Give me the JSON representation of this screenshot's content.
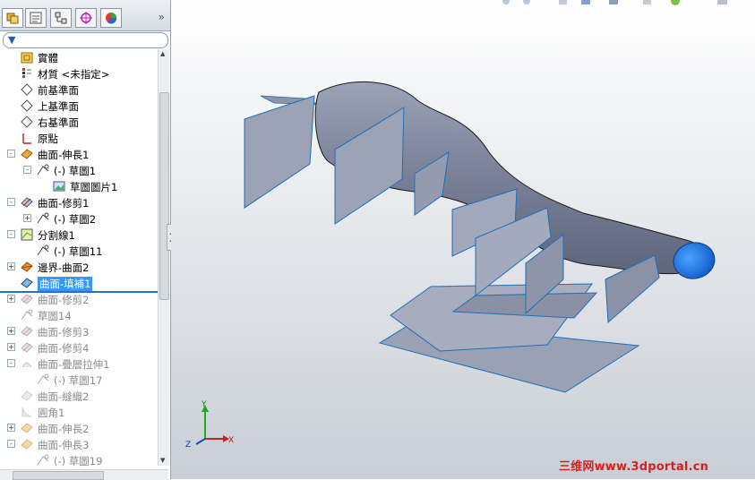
{
  "feature_tree": {
    "tabs": [
      {
        "name": "featuremanager-tab-icon"
      },
      {
        "name": "propertymanager-tab-icon"
      },
      {
        "name": "configurationmanager-tab-icon"
      },
      {
        "name": "dimxpert-tab-icon"
      },
      {
        "name": "display-manager-tab-icon"
      }
    ],
    "collapse_glyph": "»",
    "filter_icon": "filter-icon",
    "items": [
      {
        "label": "實體",
        "icon": "solid-body-folder-icon",
        "indent": 0,
        "expand": "",
        "state": "normal"
      },
      {
        "label": "材質 <未指定>",
        "icon": "material-icon",
        "indent": 0,
        "expand": "",
        "state": "normal"
      },
      {
        "label": "前基準面",
        "icon": "plane-icon",
        "indent": 0,
        "expand": "",
        "state": "normal"
      },
      {
        "label": "上基準面",
        "icon": "plane-icon",
        "indent": 0,
        "expand": "",
        "state": "normal"
      },
      {
        "label": "右基準面",
        "icon": "plane-icon",
        "indent": 0,
        "expand": "",
        "state": "normal"
      },
      {
        "label": "原點",
        "icon": "origin-icon",
        "indent": 0,
        "expand": "",
        "state": "normal"
      },
      {
        "label": "曲面-伸長1",
        "icon": "surface-extrude-icon",
        "indent": 0,
        "expand": "-",
        "state": "normal"
      },
      {
        "label": "(-) 草圖1",
        "icon": "sketch-icon",
        "indent": 1,
        "expand": "-",
        "state": "normal"
      },
      {
        "label": "草圖圖片1",
        "icon": "sketch-picture-icon",
        "indent": 2,
        "expand": "",
        "state": "normal"
      },
      {
        "label": "曲面-修剪1",
        "icon": "surface-trim-icon",
        "indent": 0,
        "expand": "-",
        "state": "normal"
      },
      {
        "label": "(-) 草圖2",
        "icon": "sketch-icon",
        "indent": 1,
        "expand": "+",
        "state": "normal"
      },
      {
        "label": "分割線1",
        "icon": "split-line-icon",
        "indent": 0,
        "expand": "-",
        "state": "normal"
      },
      {
        "label": "(-) 草圖11",
        "icon": "sketch-icon",
        "indent": 1,
        "expand": "",
        "state": "normal"
      },
      {
        "label": "邊界-曲面2",
        "icon": "boundary-surface-icon",
        "indent": 0,
        "expand": "+",
        "state": "normal"
      },
      {
        "label": "曲面-填補1",
        "icon": "surface-fill-icon",
        "indent": 0,
        "expand": "",
        "state": "selected"
      },
      {
        "label": "曲面-修剪2",
        "icon": "surface-trim-icon",
        "indent": 0,
        "expand": "+",
        "state": "dim"
      },
      {
        "label": "草圖14",
        "icon": "sketch-icon",
        "indent": 0,
        "expand": "",
        "state": "dim"
      },
      {
        "label": "曲面-修剪3",
        "icon": "surface-trim-icon",
        "indent": 0,
        "expand": "+",
        "state": "dim"
      },
      {
        "label": "曲面-修剪4",
        "icon": "surface-trim-icon",
        "indent": 0,
        "expand": "+",
        "state": "dim"
      },
      {
        "label": "曲面-疊層拉伸1",
        "icon": "surface-loft-icon",
        "indent": 0,
        "expand": "-",
        "state": "dim"
      },
      {
        "label": "(-) 草圖17",
        "icon": "sketch-icon",
        "indent": 1,
        "expand": "",
        "state": "dim"
      },
      {
        "label": "曲面-縫織2",
        "icon": "surface-knit-icon",
        "indent": 0,
        "expand": "",
        "state": "dim"
      },
      {
        "label": "圓角1",
        "icon": "fillet-icon",
        "indent": 0,
        "expand": "",
        "state": "dim"
      },
      {
        "label": "曲面-伸長2",
        "icon": "surface-extrude-icon",
        "indent": 0,
        "expand": "+",
        "state": "dim"
      },
      {
        "label": "曲面-伸長3",
        "icon": "surface-extrude-icon",
        "indent": 0,
        "expand": "-",
        "state": "dim"
      },
      {
        "label": "(-) 草圖19",
        "icon": "sketch-icon",
        "indent": 1,
        "expand": "",
        "state": "dim"
      }
    ]
  },
  "viewport": {
    "background_top": "#ffffff",
    "background_bottom": "#c9ced6",
    "model_color": "#8c93a8",
    "edge_color": "#1f6fb8",
    "triad": {
      "x": "X",
      "y": "Y",
      "z": "Z"
    }
  },
  "watermark": {
    "text": "三维网www.3dportal.cn",
    "color": "#d8201e"
  }
}
